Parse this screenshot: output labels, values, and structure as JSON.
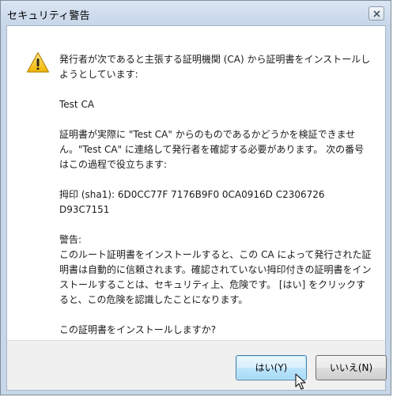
{
  "window": {
    "title": "セキュリティ警告",
    "close_symbol": "close-icon"
  },
  "icon": "warning-icon",
  "message": {
    "intro": "発行者が次であると主張する証明機関 (CA) から証明書をインストールしようとしています:",
    "ca_name": "Test CA",
    "verify_notice": "証明書が実際に \"Test CA\" からのものであるかどうかを検証できません。\"Test CA\" に連絡して発行者を確認する必要があります。 次の番号はこの過程で役立ちます:",
    "thumbprint": "拇印 (sha1): 6D0CC77F 7176B9F0 0CA0916D C2306726 D93C7151",
    "warning_label": "警告:",
    "warning_text": "このルート証明書をインストールすると、この CA によって発行された証明書は自動的に信頼されます。確認されていない拇印付きの証明書をインストールすることは、セキュリティ上、危険です。 [はい] をクリックすると、この危険を認識したことになります。",
    "question": "この証明書をインストールしますか?"
  },
  "buttons": {
    "yes": "はい(Y)",
    "no": "いいえ(N)"
  }
}
